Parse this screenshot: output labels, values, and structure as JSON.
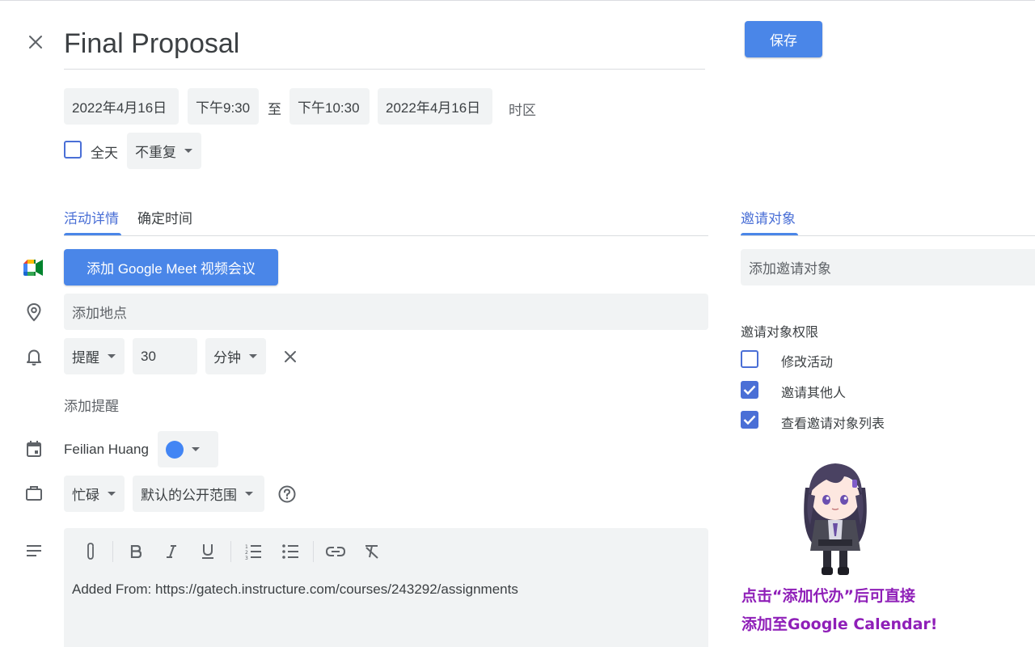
{
  "event": {
    "title": "Final Proposal",
    "save_label": "保存",
    "start_date": "2022年4月16日",
    "start_time": "下午9:30",
    "to_label": "至",
    "end_time": "下午10:30",
    "end_date": "2022年4月16日",
    "timezone_label": "时区",
    "all_day_label": "全天",
    "all_day_checked": false,
    "repeat_value": "不重复"
  },
  "tabs": {
    "details": "活动详情",
    "find_time": "确定时间",
    "guests": "邀请对象"
  },
  "details": {
    "meet_button": "添加 Google Meet 视频会议",
    "location_placeholder": "添加地点",
    "notification": {
      "type": "提醒",
      "amount": "30",
      "unit": "分钟"
    },
    "add_notification": "添加提醒",
    "calendar_owner": "Feilian Huang",
    "calendar_color": "#4285f4",
    "availability": "忙碌",
    "visibility": "默认的公开范围",
    "description": "Added From: https://gatech.instructure.com/courses/243292/assignments"
  },
  "guests": {
    "add_placeholder": "添加邀请对象",
    "permissions_title": "邀请对象权限",
    "permissions": [
      {
        "label": "修改活动",
        "checked": false
      },
      {
        "label": "邀请其他人",
        "checked": true
      },
      {
        "label": "查看邀请对象列表",
        "checked": true
      }
    ]
  },
  "promo": {
    "line1": "点击“添加代办”后可直接",
    "line2": "添加至Google Calendar!"
  },
  "colors": {
    "accent": "#4a86e8",
    "checkbox": "#4a6fd6",
    "promo_text": "#8f1fb8"
  }
}
